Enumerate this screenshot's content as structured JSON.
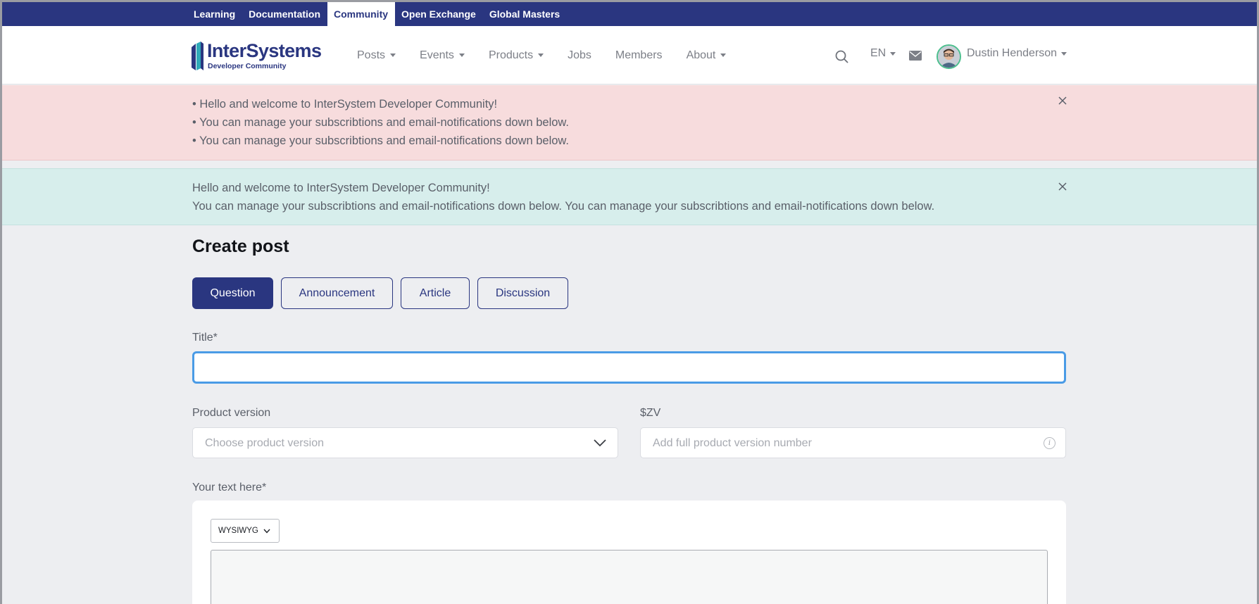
{
  "topbar": {
    "links": [
      "Learning",
      "Documentation",
      "Community",
      "Open Exchange",
      "Global Masters"
    ],
    "active": "Community"
  },
  "header": {
    "logo_word": "InterSystems",
    "logo_sub": "Developer Community",
    "nav": [
      {
        "label": "Posts",
        "has_caret": true
      },
      {
        "label": "Events",
        "has_caret": true
      },
      {
        "label": "Products",
        "has_caret": true
      },
      {
        "label": "Jobs",
        "has_caret": false
      },
      {
        "label": "Members",
        "has_caret": false
      },
      {
        "label": "About",
        "has_caret": true
      }
    ],
    "language": "EN",
    "user_name": "Dustin Henderson"
  },
  "alerts": {
    "error": [
      "• Hello and welcome to InterSystem Developer Community!",
      "• You can manage your subscribtions and email-notifications down below.",
      "• You can manage your subscribtions and email-notifications down below."
    ],
    "info": [
      "Hello and welcome to InterSystem Developer Community!",
      "You can manage your subscribtions and email-notifications down below. You can manage your subscribtions and email-notifications down below."
    ]
  },
  "form": {
    "page_title": "Create post",
    "post_types": [
      "Question",
      "Announcement",
      "Article",
      "Discussion"
    ],
    "active_type": "Question",
    "title_label": "Title*",
    "title_value": "",
    "product_version_label": "Product version",
    "product_version_placeholder": "Choose product version",
    "zv_label": "$ZV",
    "zv_placeholder": "Add full product version number",
    "text_label": "Your text here*",
    "editor_mode": "WYSIWYG"
  },
  "colors": {
    "brand": "#2a3680",
    "focus": "#4a9be6",
    "alert_error_bg": "#f7dcdd",
    "alert_info_bg": "#d7eeec",
    "page_bg": "#edeef1"
  }
}
